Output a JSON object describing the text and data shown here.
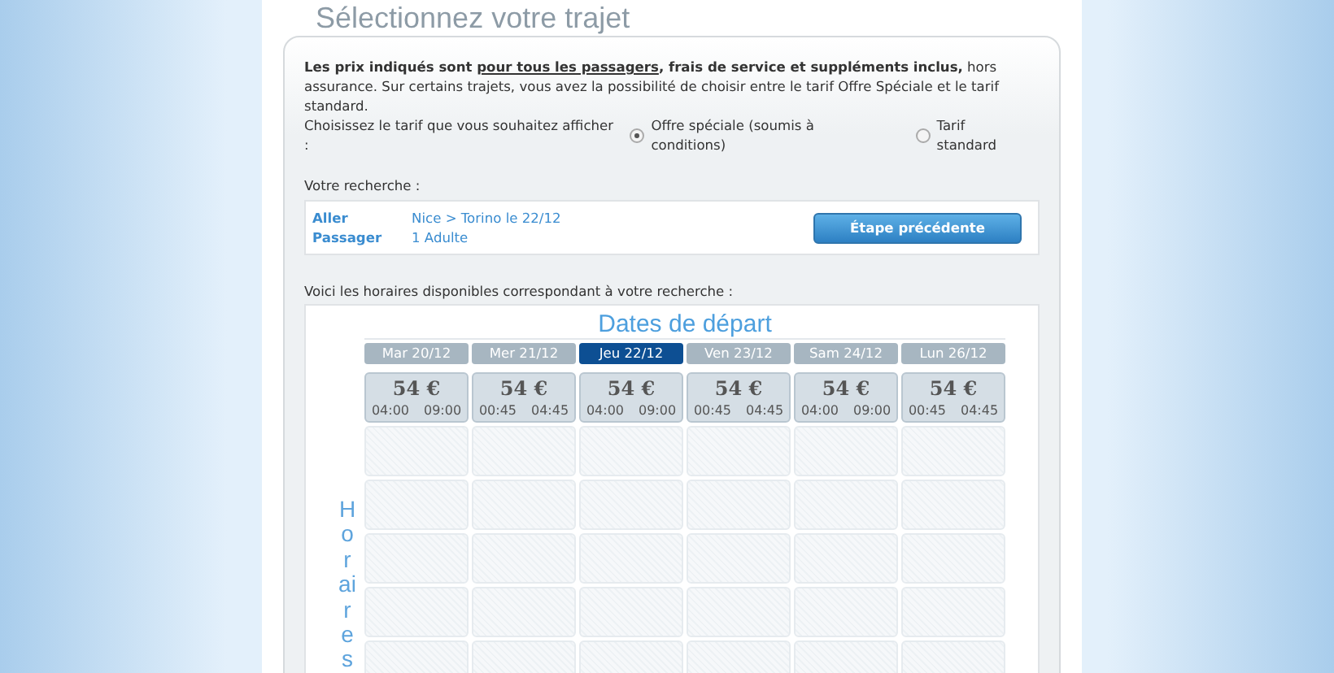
{
  "page_title": "Sélectionnez votre trajet",
  "intro": {
    "parts": [
      {
        "kind": "bold",
        "text": "Les prix indiqués sont "
      },
      {
        "kind": "link",
        "text": "pour tous les passagers"
      },
      {
        "kind": "bold",
        "text": ", frais de service et suppléments inclus,"
      },
      {
        "kind": "plain",
        "text": " hors assurance. Sur certains trajets, vous avez la possibilité de choisir entre le tarif Offre Spéciale et le tarif standard."
      }
    ]
  },
  "fare_choice": {
    "label": "Choisissez le tarif que vous souhaitez afficher :",
    "options": [
      {
        "label": "Offre spéciale (soumis à conditions)",
        "selected": true
      },
      {
        "label": "Tarif standard",
        "selected": false
      }
    ]
  },
  "search": {
    "heading": "Votre recherche :",
    "rows": [
      {
        "label": "Aller",
        "value": "Nice > Torino le 22/12"
      },
      {
        "label": "Passager",
        "value": "1 Adulte"
      }
    ],
    "back_button": "Étape précédente"
  },
  "schedule": {
    "heading": "Voici les horaires disponibles correspondant à votre recherche :",
    "title": "Dates de départ",
    "side_label": "Horaires",
    "days": [
      {
        "label": "Mar 20/12",
        "selected": false,
        "price": "54 €",
        "times": [
          "04:00",
          "09:00"
        ]
      },
      {
        "label": "Mer 21/12",
        "selected": false,
        "price": "54 €",
        "times": [
          "00:45",
          "04:45"
        ]
      },
      {
        "label": "Jeu 22/12",
        "selected": true,
        "price": "54 €",
        "times": [
          "04:00",
          "09:00"
        ]
      },
      {
        "label": "Ven 23/12",
        "selected": false,
        "price": "54 €",
        "times": [
          "00:45",
          "04:45"
        ]
      },
      {
        "label": "Sam 24/12",
        "selected": false,
        "price": "54 €",
        "times": [
          "04:00",
          "09:00"
        ]
      },
      {
        "label": "Lun 26/12",
        "selected": false,
        "price": "54 €",
        "times": [
          "00:45",
          "04:45"
        ]
      }
    ]
  }
}
